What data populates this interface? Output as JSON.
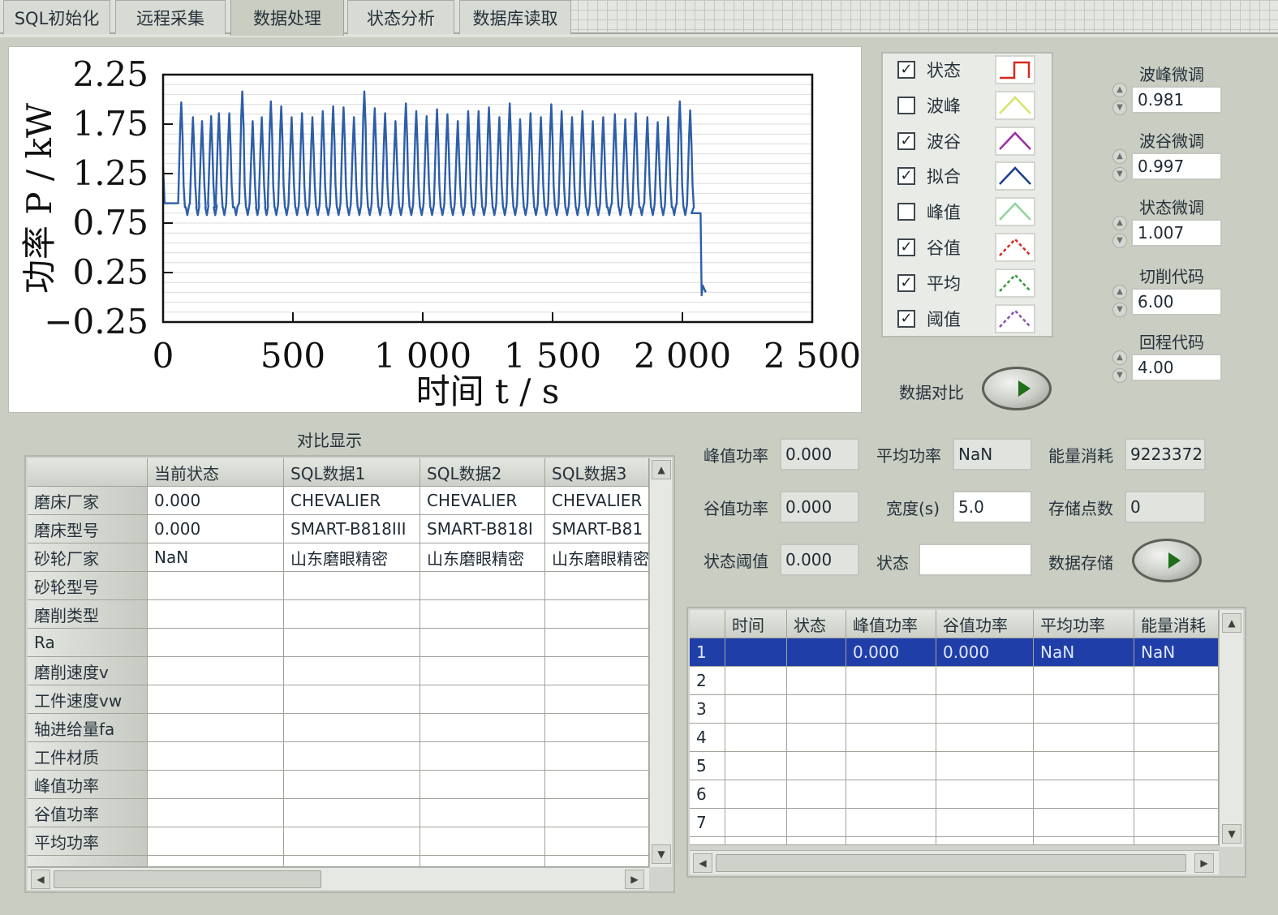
{
  "tabs": [
    "SQL初始化",
    "远程采集",
    "数据处理",
    "状态分析",
    "数据库读取"
  ],
  "active_tab": 2,
  "chart_data": {
    "type": "line",
    "ylabel": "功率 P / kW",
    "xlabel": "时间 t / s",
    "xlim": [
      0,
      2500
    ],
    "ylim": [
      -0.25,
      2.25
    ],
    "xticks": [
      "0",
      "500",
      "1 000",
      "1 500",
      "2 000",
      "2 500"
    ],
    "yticks": [
      "2.25",
      "1.75",
      "1.25",
      "0.75",
      "0.25",
      "−0.25"
    ],
    "grid": true,
    "series_color": "#2d5ea8",
    "baseline_level": 0.85,
    "dropoff_level": 0.05,
    "peaks": [
      {
        "x": 70,
        "y": 1.97
      },
      {
        "x": 115,
        "y": 1.82
      },
      {
        "x": 150,
        "y": 1.78
      },
      {
        "x": 185,
        "y": 1.83
      },
      {
        "x": 215,
        "y": 1.86
      },
      {
        "x": 255,
        "y": 1.86
      },
      {
        "x": 305,
        "y": 2.08
      },
      {
        "x": 345,
        "y": 1.78
      },
      {
        "x": 380,
        "y": 1.82
      },
      {
        "x": 415,
        "y": 1.98
      },
      {
        "x": 455,
        "y": 1.93
      },
      {
        "x": 495,
        "y": 1.82
      },
      {
        "x": 535,
        "y": 1.86
      },
      {
        "x": 575,
        "y": 1.82
      },
      {
        "x": 615,
        "y": 1.88
      },
      {
        "x": 655,
        "y": 1.93
      },
      {
        "x": 695,
        "y": 1.92
      },
      {
        "x": 735,
        "y": 1.82
      },
      {
        "x": 775,
        "y": 2.08
      },
      {
        "x": 815,
        "y": 1.91
      },
      {
        "x": 855,
        "y": 1.86
      },
      {
        "x": 895,
        "y": 1.78
      },
      {
        "x": 935,
        "y": 1.96
      },
      {
        "x": 975,
        "y": 1.88
      },
      {
        "x": 1015,
        "y": 1.83
      },
      {
        "x": 1055,
        "y": 1.9
      },
      {
        "x": 1095,
        "y": 1.85
      },
      {
        "x": 1135,
        "y": 1.78
      },
      {
        "x": 1175,
        "y": 1.88
      },
      {
        "x": 1215,
        "y": 1.88
      },
      {
        "x": 1255,
        "y": 1.92
      },
      {
        "x": 1295,
        "y": 1.82
      },
      {
        "x": 1335,
        "y": 1.96
      },
      {
        "x": 1375,
        "y": 1.8
      },
      {
        "x": 1415,
        "y": 1.86
      },
      {
        "x": 1455,
        "y": 1.82
      },
      {
        "x": 1495,
        "y": 1.95
      },
      {
        "x": 1535,
        "y": 1.88
      },
      {
        "x": 1575,
        "y": 1.82
      },
      {
        "x": 1615,
        "y": 1.88
      },
      {
        "x": 1655,
        "y": 1.78
      },
      {
        "x": 1695,
        "y": 1.82
      },
      {
        "x": 1740,
        "y": 1.85
      },
      {
        "x": 1780,
        "y": 1.8
      },
      {
        "x": 1820,
        "y": 1.86
      },
      {
        "x": 1865,
        "y": 1.82
      },
      {
        "x": 1905,
        "y": 1.77
      },
      {
        "x": 1945,
        "y": 1.82
      },
      {
        "x": 1990,
        "y": 1.98
      },
      {
        "x": 2030,
        "y": 1.89
      }
    ],
    "end_plateau_x": [
      2035,
      2070
    ],
    "drop_x": [
      2070,
      2090
    ]
  },
  "legend": [
    {
      "label": "状态",
      "checked": true,
      "icon": "step-icon",
      "color": "#d9281e",
      "dashed": false
    },
    {
      "label": "波峰",
      "checked": false,
      "icon": "peak-icon",
      "color": "#d7e36a",
      "dashed": false
    },
    {
      "label": "波谷",
      "checked": true,
      "icon": "peak-icon",
      "color": "#9b2fa4",
      "dashed": false
    },
    {
      "label": "拟合",
      "checked": true,
      "icon": "peak-icon",
      "color": "#1c3f8f",
      "dashed": false
    },
    {
      "label": "峰值",
      "checked": false,
      "icon": "peak-icon",
      "color": "#8fd49a",
      "dashed": false
    },
    {
      "label": "谷值",
      "checked": true,
      "icon": "peak-icon",
      "color": "#d9281e",
      "dashed": true
    },
    {
      "label": "平均",
      "checked": true,
      "icon": "peak-icon",
      "color": "#2f9a38",
      "dashed": true
    },
    {
      "label": "阈值",
      "checked": true,
      "icon": "peak-icon",
      "color": "#8a4fb0",
      "dashed": true
    }
  ],
  "tuning": [
    {
      "label": "波峰微调",
      "value": "0.981"
    },
    {
      "label": "波谷微调",
      "value": "0.997"
    },
    {
      "label": "状态微调",
      "value": "1.007"
    },
    {
      "label": "切削代码",
      "value": "6.00"
    },
    {
      "label": "回程代码",
      "value": "4.00"
    }
  ],
  "compare_button": "数据对比",
  "store_button": "数据存储",
  "readouts": {
    "peak_power": {
      "label": "峰值功率",
      "value": "0.000"
    },
    "avg_power": {
      "label": "平均功率",
      "value": "NaN"
    },
    "energy": {
      "label": "能量消耗",
      "value": "9223372"
    },
    "valley_power": {
      "label": "谷值功率",
      "value": "0.000"
    },
    "width": {
      "label": "宽度(s)",
      "value": "5.0"
    },
    "stored": {
      "label": "存储点数",
      "value": "0"
    },
    "state_threshold": {
      "label": "状态阈值",
      "value": "0.000"
    },
    "state": {
      "label": "状态",
      "value": ""
    }
  },
  "compare": {
    "title": "对比显示",
    "columns": [
      "",
      "当前状态",
      "SQL数据1",
      "SQL数据2",
      "SQL数据3"
    ],
    "rows": [
      {
        "label": "磨床厂家",
        "cells": [
          "0.000",
          "CHEVALIER",
          "CHEVALIER",
          "CHEVALIER"
        ]
      },
      {
        "label": "磨床型号",
        "cells": [
          "0.000",
          "SMART-B818III",
          "SMART-B818I",
          "SMART-B81"
        ]
      },
      {
        "label": "砂轮厂家",
        "cells": [
          "NaN",
          "山东磨眼精密",
          "山东磨眼精密",
          "山东磨眼精密"
        ]
      },
      {
        "label": "砂轮型号",
        "cells": [
          "",
          "",
          "",
          ""
        ]
      },
      {
        "label": "磨削类型",
        "cells": [
          "",
          "",
          "",
          ""
        ]
      },
      {
        "label": "Ra",
        "cells": [
          "",
          "",
          "",
          ""
        ]
      },
      {
        "label": "磨削速度v",
        "cells": [
          "",
          "",
          "",
          ""
        ]
      },
      {
        "label": "工件速度vw",
        "cells": [
          "",
          "",
          "",
          ""
        ]
      },
      {
        "label": "轴进给量fa",
        "cells": [
          "",
          "",
          "",
          ""
        ]
      },
      {
        "label": "工件材质",
        "cells": [
          "",
          "",
          "",
          ""
        ]
      },
      {
        "label": "峰值功率",
        "cells": [
          "",
          "",
          "",
          ""
        ]
      },
      {
        "label": "谷值功率",
        "cells": [
          "",
          "",
          "",
          ""
        ]
      },
      {
        "label": "平均功率",
        "cells": [
          "",
          "",
          "",
          ""
        ]
      }
    ]
  },
  "datatable": {
    "columns": [
      "",
      "时间",
      "状态",
      "峰值功率",
      "谷值功率",
      "平均功率",
      "能量消耗"
    ],
    "rows": [
      {
        "index": "1",
        "cells": [
          "",
          "",
          "0.000",
          "0.000",
          "NaN",
          "NaN"
        ],
        "selected": true
      },
      {
        "index": "2",
        "cells": [
          "",
          "",
          "",
          "",
          "",
          ""
        ]
      },
      {
        "index": "3",
        "cells": [
          "",
          "",
          "",
          "",
          "",
          ""
        ]
      },
      {
        "index": "4",
        "cells": [
          "",
          "",
          "",
          "",
          "",
          ""
        ]
      },
      {
        "index": "5",
        "cells": [
          "",
          "",
          "",
          "",
          "",
          ""
        ]
      },
      {
        "index": "6",
        "cells": [
          "",
          "",
          "",
          "",
          "",
          ""
        ]
      },
      {
        "index": "7",
        "cells": [
          "",
          "",
          "",
          "",
          "",
          ""
        ]
      }
    ]
  }
}
